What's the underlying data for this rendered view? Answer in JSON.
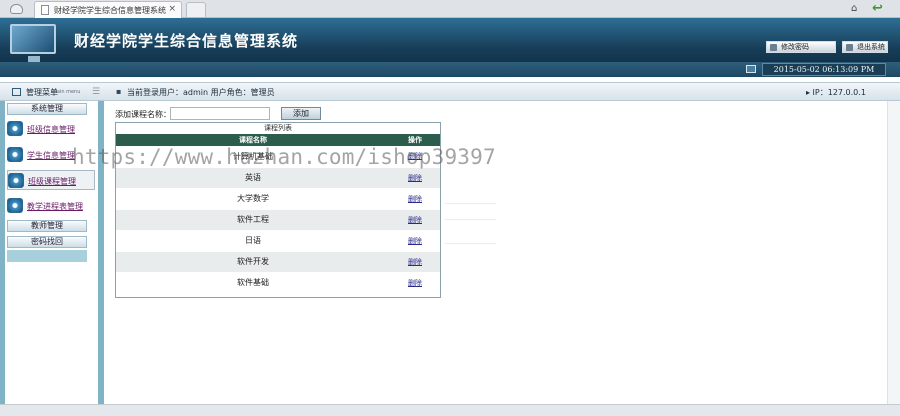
{
  "browser": {
    "tab_title": "财经学院学生综合信息管理系统",
    "tab_close": "×",
    "home_glyph": "⌂",
    "back_glyph": "↩"
  },
  "header": {
    "title": "财经学院学生综合信息管理系统",
    "change_password": "修改密码",
    "logout": "退出系统",
    "datetime": "2015-05-02 06:13:09 PM"
  },
  "menubar": {
    "menu_title": "管理菜单",
    "menu_sub": "main menu",
    "lines_glyph": "☰",
    "bullet": "▪",
    "user_info": "当前登录用户：admin 用户角色：管理员",
    "ip": "▸ IP：127.0.0.1"
  },
  "sidebar": {
    "sections": [
      {
        "label": "系统管理"
      },
      {
        "label": "教师管理"
      },
      {
        "label": "密码找回"
      }
    ],
    "items": [
      {
        "label": "班级信息管理"
      },
      {
        "label": "学生信息管理"
      },
      {
        "label": "班级课程管理"
      },
      {
        "label": "教学进程表管理"
      }
    ]
  },
  "main": {
    "add_label": "添加课程名称：",
    "add_input_value": "",
    "add_button": "添加",
    "list_caption": "课程列表",
    "columns": [
      "课程名称",
      "操作"
    ],
    "rows": [
      {
        "name": "计算机基础",
        "op": "删除"
      },
      {
        "name": "英语",
        "op": "删除"
      },
      {
        "name": "大学数学",
        "op": "删除"
      },
      {
        "name": "软件工程",
        "op": "删除"
      },
      {
        "name": "日语",
        "op": "删除"
      },
      {
        "name": "软件开发",
        "op": "删除"
      },
      {
        "name": "软件基础",
        "op": "删除"
      }
    ]
  },
  "watermark": "https://www.huzhan.com/ishop39397"
}
